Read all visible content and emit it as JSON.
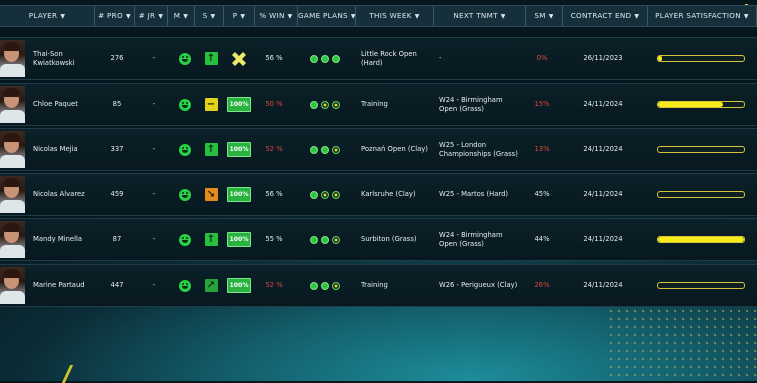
{
  "columns": [
    {
      "key": "player",
      "label": "PLAYER",
      "sortable": true
    },
    {
      "key": "pro",
      "label": "# PRO",
      "sortable": true
    },
    {
      "key": "jr",
      "label": "# JR",
      "sortable": true
    },
    {
      "key": "m",
      "label": "M",
      "sortable": true
    },
    {
      "key": "s",
      "label": "S",
      "sortable": true
    },
    {
      "key": "p",
      "label": "P",
      "sortable": true
    },
    {
      "key": "win",
      "label": "% WIN",
      "sortable": true
    },
    {
      "key": "plans",
      "label": "GAME PLANS",
      "sortable": true
    },
    {
      "key": "week",
      "label": "THIS WEEK",
      "sortable": true
    },
    {
      "key": "next",
      "label": "NEXT TNMT",
      "sortable": true
    },
    {
      "key": "sm",
      "label": "SM",
      "sortable": true
    },
    {
      "key": "contract",
      "label": "CONTRACT END",
      "sortable": true
    },
    {
      "key": "satis",
      "label": "PLAYER SATISFACTION",
      "sortable": true
    }
  ],
  "colors": {
    "accent_yellow": "#f6ec1a",
    "green": "#28d146",
    "red": "#e0473c",
    "orange": "#e58b1d"
  },
  "players": [
    {
      "name": "Thai-Son Kwiatkowski",
      "pro": "276",
      "jr": "-",
      "mood_icon": "smiley-icon",
      "trend": "up",
      "trend_icon": "arrow-up-icon",
      "p_type": "x-icon",
      "p_value": "",
      "win": "56 %",
      "win_red": false,
      "plans": [
        "dot",
        "dot",
        "dot"
      ],
      "week": "Little Rock Open (Hard)",
      "next": "-",
      "sm": "0%",
      "sm_red": true,
      "contract": "26/11/2023",
      "satisfaction": 0.04
    },
    {
      "name": "Chloe Paquet",
      "pro": "85",
      "jr": "-",
      "mood_icon": "smiley-icon",
      "trend": "flat",
      "trend_icon": "minus-icon",
      "p_type": "badge",
      "p_value": "100%",
      "win": "50 %",
      "win_red": true,
      "plans": [
        "dot",
        "ring",
        "ring"
      ],
      "week": "Training",
      "next": "W24 - Birmingham Open (Grass)",
      "sm": "15%",
      "sm_red": true,
      "contract": "24/11/2024",
      "satisfaction": 0.75
    },
    {
      "name": "Nicolas Mejia",
      "pro": "337",
      "jr": "-",
      "mood_icon": "smiley-icon",
      "trend": "up",
      "trend_icon": "arrow-up-icon",
      "p_type": "badge",
      "p_value": "100%",
      "win": "52 %",
      "win_red": true,
      "plans": [
        "dot",
        "dot",
        "ring"
      ],
      "week": "Poznań Open (Clay)",
      "next": "W25 - London Championships (Grass)",
      "sm": "13%",
      "sm_red": true,
      "contract": "24/11/2024",
      "satisfaction": 0.0
    },
    {
      "name": "Nicolas Alvarez",
      "pro": "459",
      "jr": "-",
      "mood_icon": "smiley-icon",
      "trend": "down",
      "trend_icon": "arrow-down-right-icon",
      "p_type": "badge",
      "p_value": "100%",
      "win": "56 %",
      "win_red": false,
      "plans": [
        "dot",
        "ring",
        "ring"
      ],
      "week": "Karlsruhe (Clay)",
      "next": "W25 - Martos (Hard)",
      "sm": "45%",
      "sm_red": false,
      "contract": "24/11/2024",
      "satisfaction": 0.0
    },
    {
      "name": "Mandy Minella",
      "pro": "87",
      "jr": "-",
      "mood_icon": "smiley-icon",
      "trend": "up",
      "trend_icon": "arrow-up-icon",
      "p_type": "badge",
      "p_value": "100%",
      "win": "55 %",
      "win_red": false,
      "plans": [
        "dot",
        "dot",
        "ring"
      ],
      "week": "Surbiton (Grass)",
      "next": "W24 - Birmingham Open (Grass)",
      "sm": "44%",
      "sm_red": false,
      "contract": "24/11/2024",
      "satisfaction": 1.0
    },
    {
      "name": "Marine Partaud",
      "pro": "447",
      "jr": "-",
      "mood_icon": "smiley-icon",
      "trend": "upright",
      "trend_icon": "arrow-up-right-icon",
      "p_type": "badge",
      "p_value": "100%",
      "win": "52 %",
      "win_red": true,
      "plans": [
        "dot",
        "dot",
        "ring"
      ],
      "week": "Training",
      "next": "W26 - Perigueux (Clay)",
      "sm": "26%",
      "sm_red": true,
      "contract": "24/11/2024",
      "satisfaction": 0.0
    }
  ]
}
